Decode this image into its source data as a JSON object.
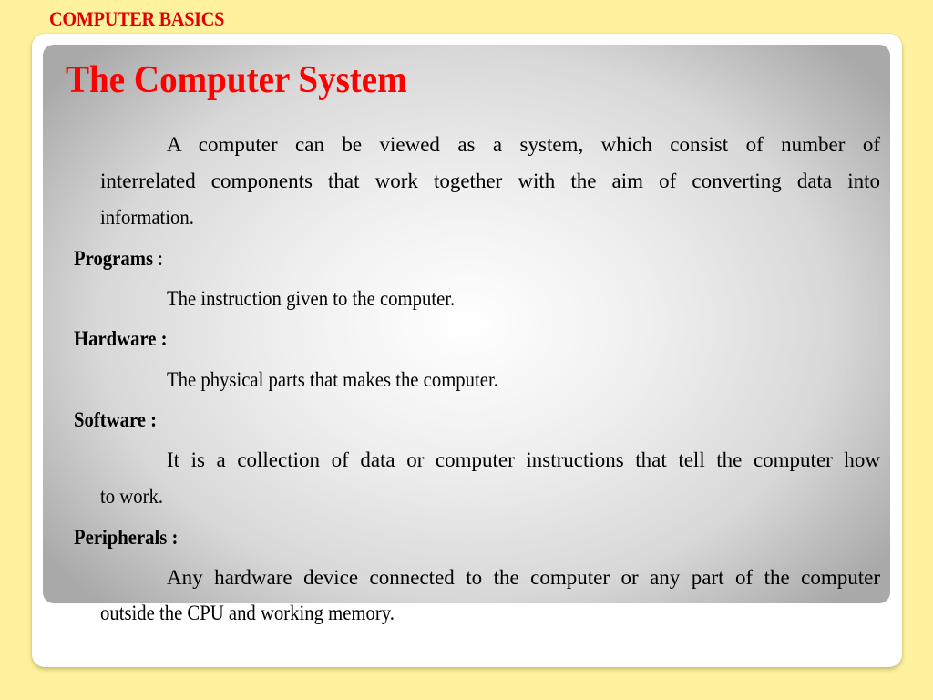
{
  "header": {
    "section_label": "COMPUTER BASICS"
  },
  "slide": {
    "title": "The Computer System",
    "intro": {
      "line1": "A computer can be viewed as a system, which consist of number of",
      "line2": "interrelated components that work together with the aim of converting data into",
      "line3": "information."
    },
    "terms": [
      {
        "term": "Programs",
        "separator": " :",
        "definition_lines": [
          "The instruction given to the computer."
        ]
      },
      {
        "term": "Hardware",
        "separator": " :",
        "definition_lines": [
          "The physical parts that makes the computer."
        ]
      },
      {
        "term": "Software",
        "separator": " :",
        "definition_lines": [
          "It is a collection of data or computer instructions that tell the computer how",
          "to work."
        ]
      },
      {
        "term": "Peripherals",
        "separator": " :",
        "definition_lines": [
          "Any hardware device connected to the computer or any part of the computer",
          "outside the CPU and working memory."
        ]
      }
    ]
  },
  "colors": {
    "background": "#fff29f",
    "accent_red": "#ff0000",
    "header_red": "#e00000",
    "card": "#ffffff",
    "text": "#000000"
  }
}
